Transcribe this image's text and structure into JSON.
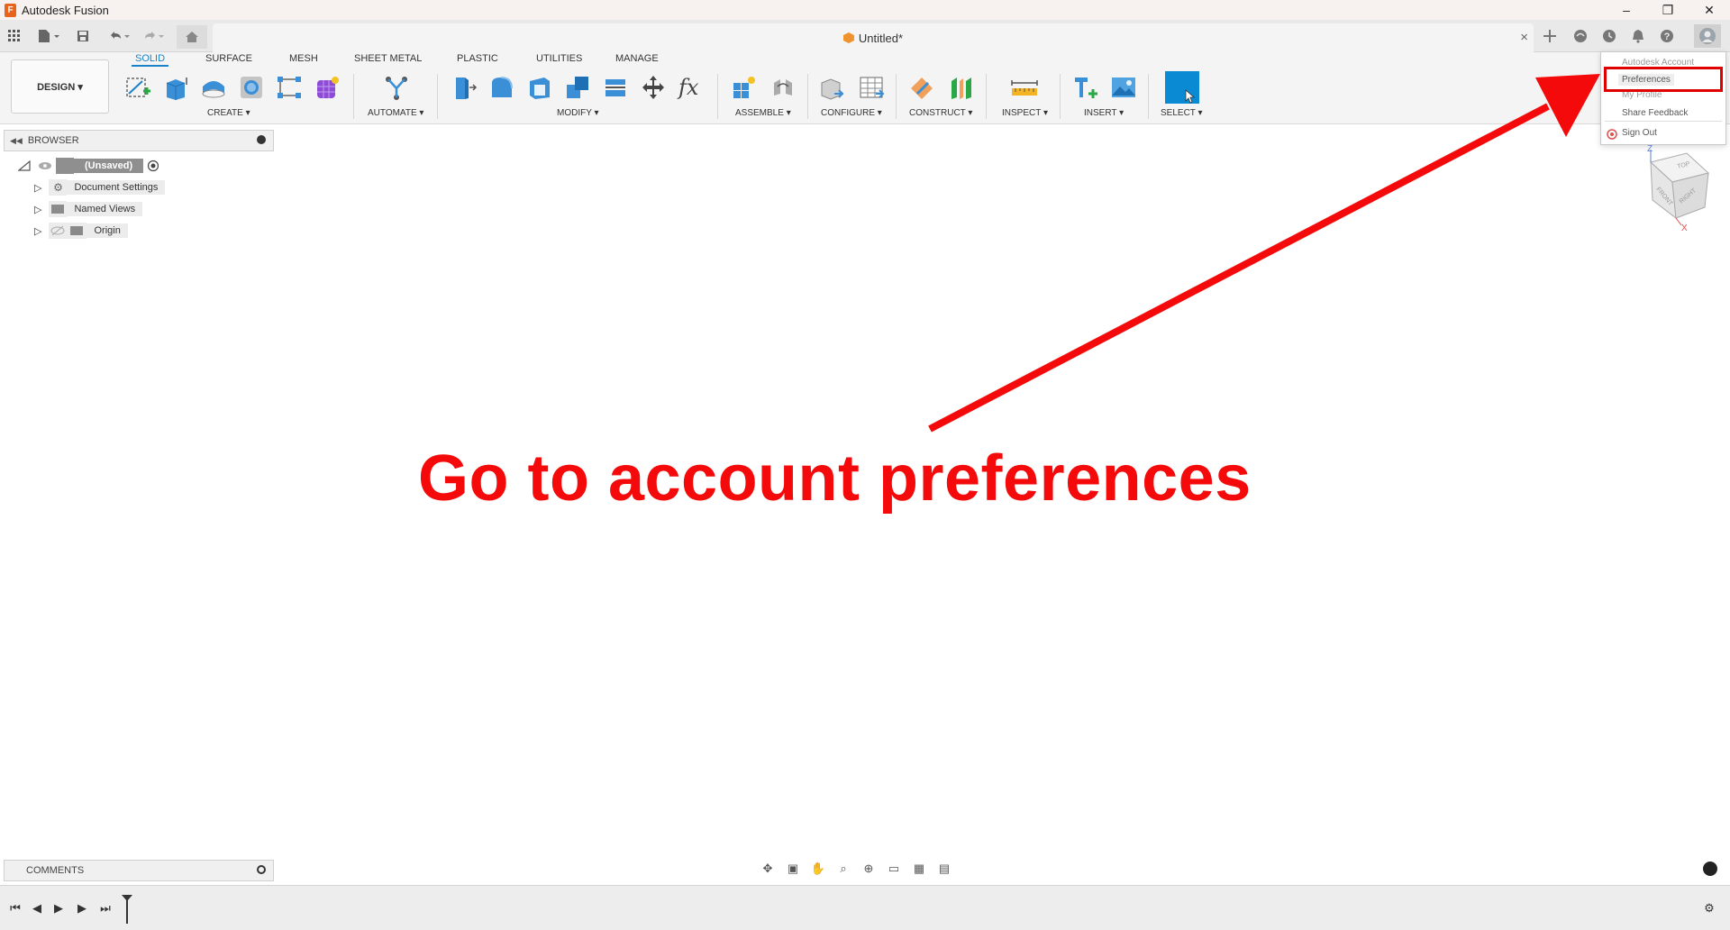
{
  "window": {
    "title": "Autodesk Fusion",
    "controls": [
      "–",
      "❐",
      "✕"
    ]
  },
  "quick_access": {
    "icons": [
      "grid-icon",
      "file-icon",
      "save-icon",
      "undo-icon",
      "redo-icon",
      "home-icon"
    ]
  },
  "document_tab": {
    "title": "Untitled*",
    "close": "×"
  },
  "right_toolbar": {
    "icons": [
      "new-tab-icon",
      "online-status-icon",
      "job-status-icon",
      "notification-bell-icon",
      "help-icon",
      "profile-avatar-icon"
    ]
  },
  "ribbon": {
    "tabs": [
      "SOLID",
      "SURFACE",
      "MESH",
      "SHEET METAL",
      "PLASTIC",
      "UTILITIES",
      "MANAGE"
    ],
    "active_tab": "SOLID",
    "workspace_button": "DESIGN ▾",
    "groups": {
      "create": "CREATE ▾",
      "automate": "AUTOMATE ▾",
      "modify": "MODIFY ▾",
      "assemble": "ASSEMBLE ▾",
      "configure": "CONFIGURE ▾",
      "construct": "CONSTRUCT ▾",
      "inspect": "INSPECT ▾",
      "insert": "INSERT ▾",
      "select": "SELECT ▾"
    }
  },
  "browser": {
    "header": "BROWSER",
    "root": "(Unsaved)",
    "items": [
      "Document Settings",
      "Named Views",
      "Origin"
    ]
  },
  "account_menu": {
    "items": [
      "Autodesk Account",
      "Preferences",
      "My Profile",
      "Share Feedback",
      "Sign Out"
    ],
    "highlighted": "Preferences"
  },
  "annotation": {
    "text": "Go to account preferences",
    "color": "#f40a0a"
  },
  "viewcube": {
    "faces": [
      "TOP",
      "FRONT",
      "RIGHT"
    ],
    "axes": [
      "Z",
      "X"
    ]
  },
  "comments": {
    "header": "COMMENTS"
  },
  "colors": {
    "accent": "#1a82c8",
    "select_blue": "#0b8ad4",
    "highlight_red": "#e00000"
  }
}
